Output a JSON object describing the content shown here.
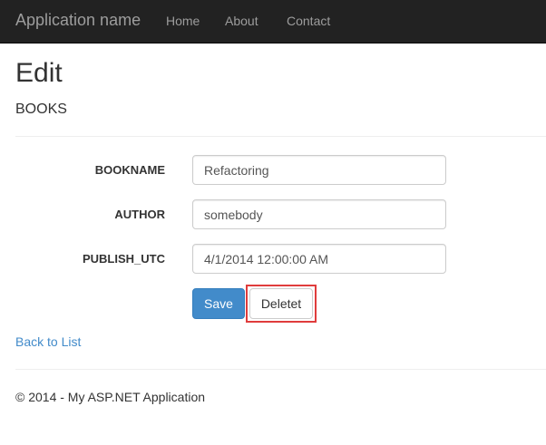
{
  "navbar": {
    "brand": "Application name",
    "links": [
      {
        "label": "Home"
      },
      {
        "label": "About"
      },
      {
        "label": "Contact"
      }
    ]
  },
  "page": {
    "title": "Edit",
    "entity": "BOOKS"
  },
  "form": {
    "fields": [
      {
        "label": "BOOKNAME",
        "value": "Refactoring"
      },
      {
        "label": "AUTHOR",
        "value": "somebody"
      },
      {
        "label": "PUBLISH_UTC",
        "value": "4/1/2014 12:00:00 AM"
      }
    ],
    "save_label": "Save",
    "delete_label": "Deletet"
  },
  "back_link": "Back to List",
  "footer": "© 2014 - My ASP.NET Application",
  "colors": {
    "navbar_bg": "#222222",
    "primary": "#428bca",
    "highlight": "#e03c3c"
  }
}
